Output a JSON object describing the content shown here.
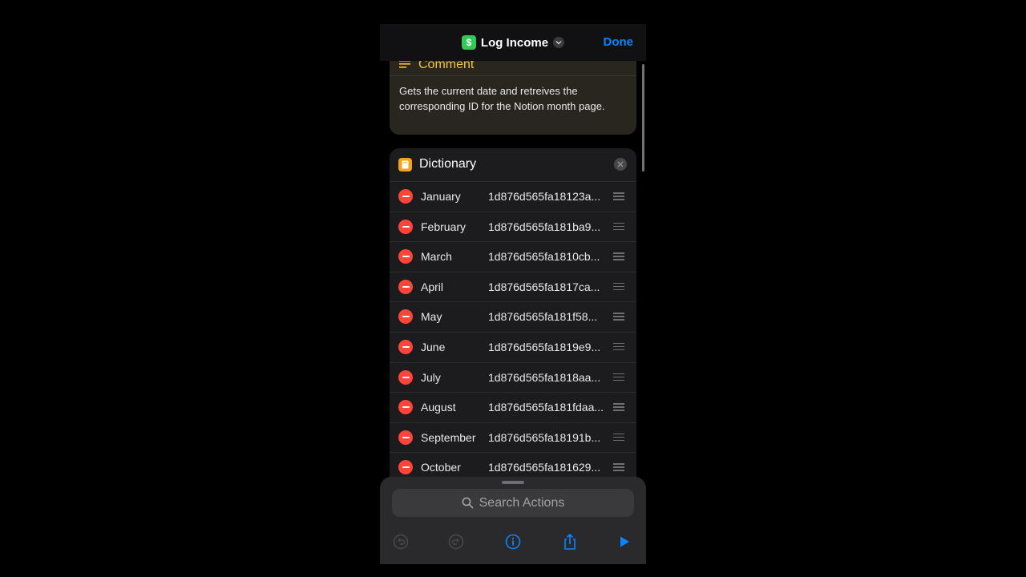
{
  "nav": {
    "title": "Log Income",
    "done_label": "Done",
    "app_icon_glyph": "$"
  },
  "comment": {
    "title": "Comment",
    "body": "Gets the current date and retreives the corresponding ID for the Notion month page."
  },
  "dictionary": {
    "title": "Dictionary",
    "rows": [
      {
        "key": "January",
        "value": "1d876d565fa18123a..."
      },
      {
        "key": "February",
        "value": "1d876d565fa181ba9..."
      },
      {
        "key": "March",
        "value": "1d876d565fa1810cb..."
      },
      {
        "key": "April",
        "value": "1d876d565fa1817ca..."
      },
      {
        "key": "May",
        "value": "1d876d565fa181f58..."
      },
      {
        "key": "June",
        "value": "1d876d565fa1819e9..."
      },
      {
        "key": "July",
        "value": "1d876d565fa1818aa..."
      },
      {
        "key": "August",
        "value": "1d876d565fa181fdaa..."
      },
      {
        "key": "September",
        "value": "1d876d565fa18191b..."
      },
      {
        "key": "October",
        "value": "1d876d565fa181629..."
      }
    ]
  },
  "sheet": {
    "search_placeholder": "Search Actions"
  },
  "icons": {
    "comment": "lines-icon",
    "dictionary": "book-icon",
    "search": "magnifier-icon",
    "undo": "undo-icon",
    "redo": "redo-icon",
    "info": "info-icon",
    "share": "share-icon",
    "run": "play-icon"
  },
  "colors": {
    "accent": "#0a84ff",
    "comment_title": "#f5c542",
    "remove": "#ff453a",
    "app_icon": "#34c759"
  }
}
